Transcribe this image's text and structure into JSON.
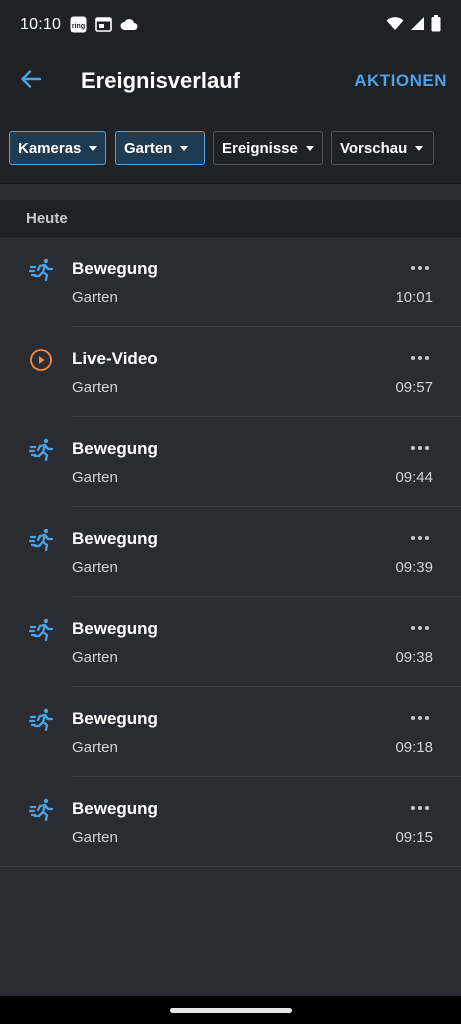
{
  "status_bar": {
    "time": "10:10",
    "left_icons": [
      "ring-app-icon",
      "calendar-notification-icon",
      "cloud-icon"
    ],
    "right_icons": [
      "wifi-icon",
      "cell-signal-icon",
      "battery-icon"
    ]
  },
  "header": {
    "title": "Ereignisverlauf",
    "action_label": "AKTIONEN",
    "back_icon": "arrow-left-icon",
    "accent_color": "#4aa3e6"
  },
  "filters": [
    {
      "label": "Kameras",
      "active": true
    },
    {
      "label": "Garten",
      "active": true
    },
    {
      "label": "Ereignisse",
      "active": false
    },
    {
      "label": "Vorschau",
      "active": false
    }
  ],
  "section": {
    "title": "Heute"
  },
  "events": [
    {
      "type": "motion",
      "icon": "motion-runner-icon",
      "title": "Bewegung",
      "location": "Garten",
      "time": "10:01"
    },
    {
      "type": "live",
      "icon": "play-circle-icon",
      "title": "Live-Video",
      "location": "Garten",
      "time": "09:57"
    },
    {
      "type": "motion",
      "icon": "motion-runner-icon",
      "title": "Bewegung",
      "location": "Garten",
      "time": "09:44"
    },
    {
      "type": "motion",
      "icon": "motion-runner-icon",
      "title": "Bewegung",
      "location": "Garten",
      "time": "09:39"
    },
    {
      "type": "motion",
      "icon": "motion-runner-icon",
      "title": "Bewegung",
      "location": "Garten",
      "time": "09:38"
    },
    {
      "type": "motion",
      "icon": "motion-runner-icon",
      "title": "Bewegung",
      "location": "Garten",
      "time": "09:18"
    },
    {
      "type": "motion",
      "icon": "motion-runner-icon",
      "title": "Bewegung",
      "location": "Garten",
      "time": "09:15"
    }
  ],
  "colors": {
    "motion_icon": "#4aa3e6",
    "live_icon": "#f08a3c",
    "background": "#2b2c31",
    "header_background": "#202125"
  }
}
